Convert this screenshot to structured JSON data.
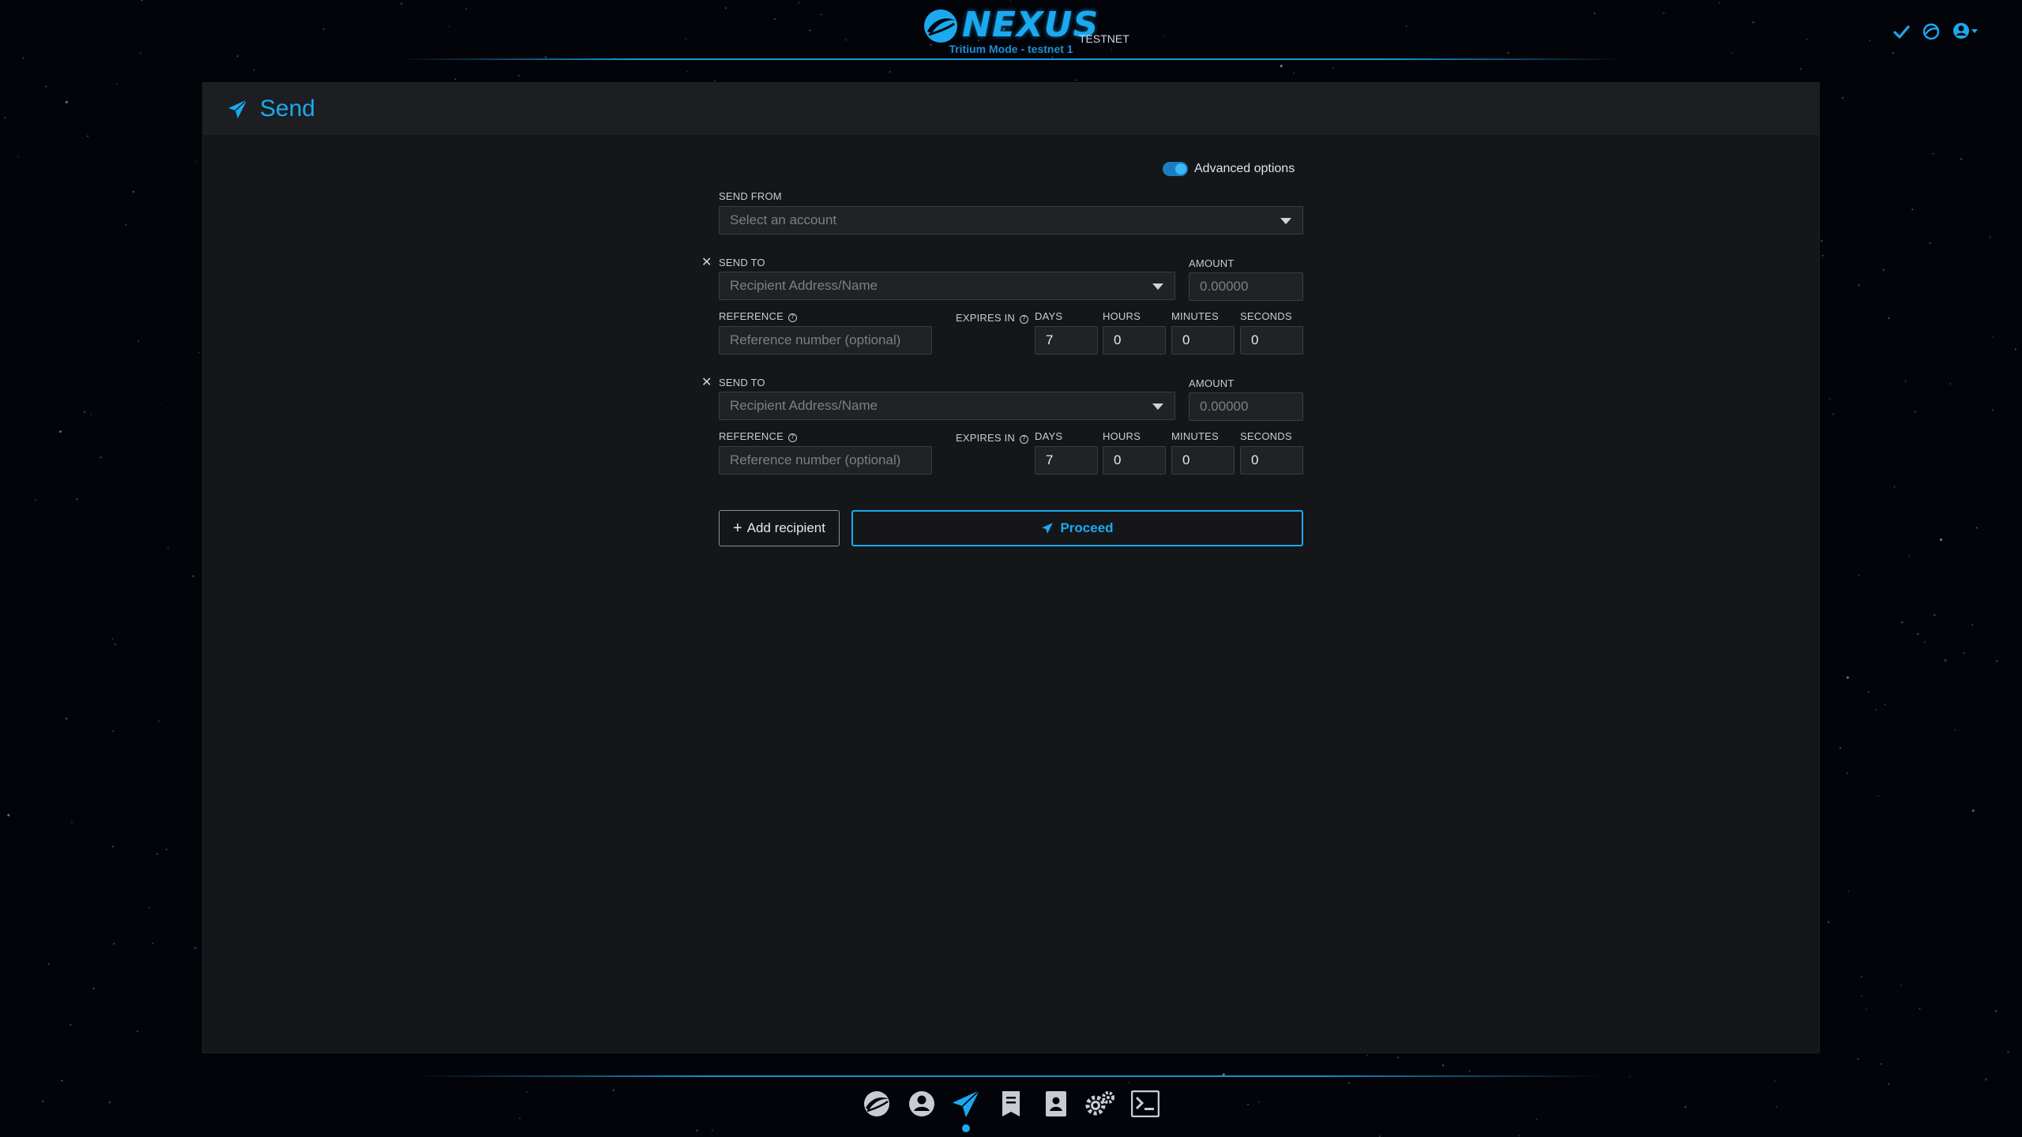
{
  "app": {
    "brand": "NEXUS",
    "network_tag": "TESTNET",
    "mode_line": "Tritium Mode - testnet 1",
    "status_icons": [
      "check-icon",
      "sync-logo-icon",
      "user-dropdown-icon"
    ]
  },
  "page": {
    "title": "Send",
    "title_icon": "paper-plane-icon"
  },
  "form": {
    "advanced_options": {
      "label": "Advanced options",
      "enabled": true
    },
    "send_from": {
      "label": "SEND FROM",
      "placeholder": "Select an account"
    },
    "recipients": [
      {
        "send_to_label": "SEND TO",
        "address_placeholder": "Recipient Address/Name",
        "amount_label": "AMOUNT",
        "amount_placeholder": "0.00000",
        "reference_label": "REFERENCE",
        "reference_placeholder": "Reference number (optional)",
        "expires_label": "EXPIRES IN",
        "days_label": "DAYS",
        "days": "7",
        "hours_label": "HOURS",
        "hours": "0",
        "minutes_label": "MINUTES",
        "minutes": "0",
        "seconds_label": "SECONDS",
        "seconds": "0"
      },
      {
        "send_to_label": "SEND TO",
        "address_placeholder": "Recipient Address/Name",
        "amount_label": "AMOUNT",
        "amount_placeholder": "0.00000",
        "reference_label": "REFERENCE",
        "reference_placeholder": "Reference number (optional)",
        "expires_label": "EXPIRES IN",
        "days_label": "DAYS",
        "days": "7",
        "hours_label": "HOURS",
        "hours": "0",
        "minutes_label": "MINUTES",
        "minutes": "0",
        "seconds_label": "SECONDS",
        "seconds": "0"
      }
    ],
    "add_recipient_label": "Add recipient",
    "proceed_label": "Proceed"
  },
  "nav": {
    "items": [
      {
        "icon": "nexus-logo-icon"
      },
      {
        "icon": "user-icon"
      },
      {
        "icon": "send-icon",
        "active": true
      },
      {
        "icon": "transactions-icon"
      },
      {
        "icon": "address-book-icon"
      },
      {
        "icon": "settings-icon"
      },
      {
        "icon": "terminal-icon"
      }
    ]
  },
  "colors": {
    "accent": "#1ba9ef",
    "panel_bg": "#141619",
    "panel_header_bg": "#1c1e22",
    "field_bg": "#202226",
    "page_bg": "#02040a"
  }
}
